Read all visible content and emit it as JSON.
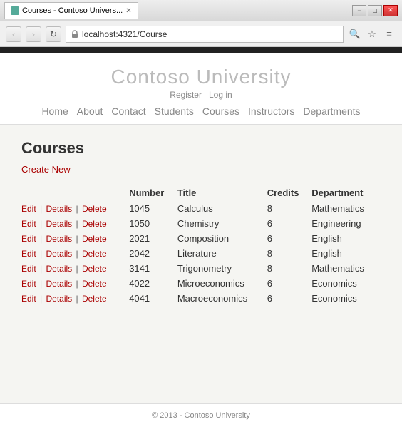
{
  "window": {
    "title": "Courses - Contoso Univers...",
    "url": "localhost:4321/Course"
  },
  "titlebar": {
    "minimize": "−",
    "maximize": "□",
    "close": "✕"
  },
  "nav": {
    "back": "‹",
    "forward": "›",
    "refresh": "↻"
  },
  "site": {
    "title": "Contoso University",
    "auth_register": "Register",
    "auth_login": "Log in",
    "nav_items": [
      "Home",
      "About",
      "Contact",
      "Students",
      "Courses",
      "Instructors",
      "Departments"
    ]
  },
  "page": {
    "heading": "Courses",
    "create_new": "Create New",
    "table": {
      "headers": [
        "",
        "Number",
        "Title",
        "Credits",
        "Department"
      ],
      "rows": [
        {
          "actions": [
            "Edit",
            "Details",
            "Delete"
          ],
          "number": "1045",
          "title": "Calculus",
          "credits": "8",
          "department": "Mathematics"
        },
        {
          "actions": [
            "Edit",
            "Details",
            "Delete"
          ],
          "number": "1050",
          "title": "Chemistry",
          "credits": "6",
          "department": "Engineering"
        },
        {
          "actions": [
            "Edit",
            "Details",
            "Delete"
          ],
          "number": "2021",
          "title": "Composition",
          "credits": "6",
          "department": "English"
        },
        {
          "actions": [
            "Edit",
            "Details",
            "Delete"
          ],
          "number": "2042",
          "title": "Literature",
          "credits": "8",
          "department": "English"
        },
        {
          "actions": [
            "Edit",
            "Details",
            "Delete"
          ],
          "number": "3141",
          "title": "Trigonometry",
          "credits": "8",
          "department": "Mathematics"
        },
        {
          "actions": [
            "Edit",
            "Details",
            "Delete"
          ],
          "number": "4022",
          "title": "Microeconomics",
          "credits": "6",
          "department": "Economics"
        },
        {
          "actions": [
            "Edit",
            "Details",
            "Delete"
          ],
          "number": "4041",
          "title": "Macroeconomics",
          "credits": "6",
          "department": "Economics"
        }
      ]
    }
  },
  "footer": {
    "text": "© 2013 - Contoso University"
  }
}
